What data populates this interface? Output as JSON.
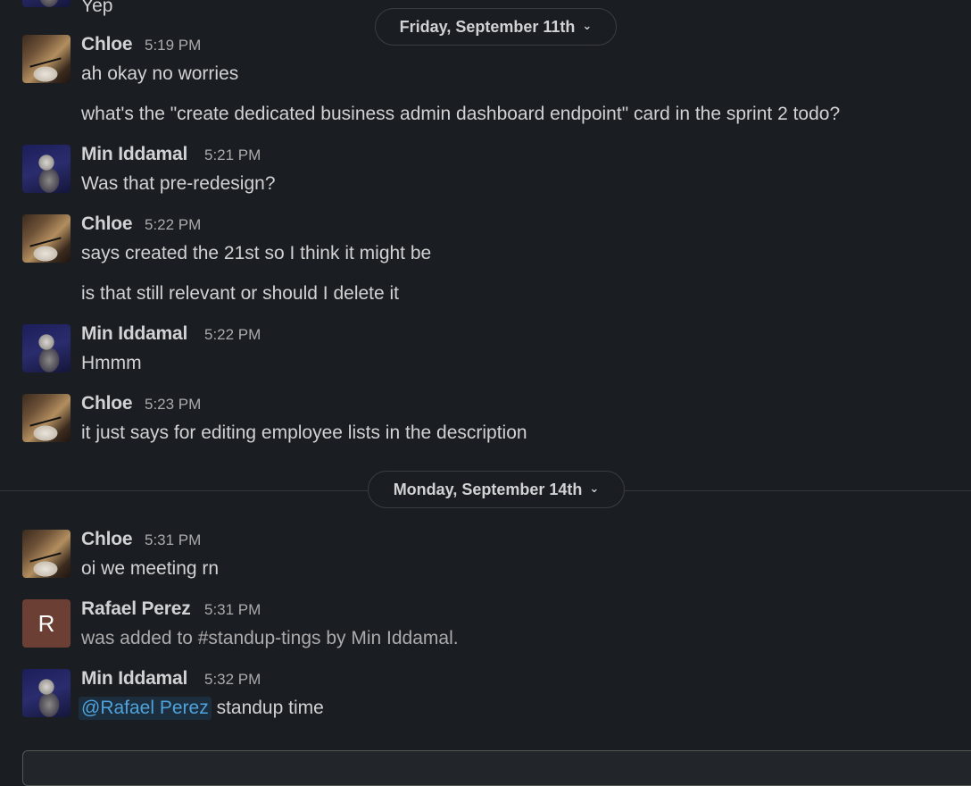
{
  "top_partial": {
    "text": "Yep"
  },
  "dividers": [
    {
      "label": "Friday, September 11th",
      "icon": "chevron-down-icon"
    },
    {
      "label": "Monday, September 14th",
      "icon": "chevron-down-icon"
    }
  ],
  "messages": [
    {
      "name": "Chloe",
      "time": "5:19 PM",
      "lines": [
        "ah okay no worries",
        "what's the \"create dedicated business admin dashboard endpoint\" card in the sprint 2 todo?"
      ]
    },
    {
      "name": "Min Iddamal",
      "time": "5:21 PM",
      "lines": [
        "Was that pre-redesign?"
      ]
    },
    {
      "name": "Chloe",
      "time": "5:22 PM",
      "lines": [
        "says created the 21st so I think it might be",
        "is that still relevant or should I delete it"
      ]
    },
    {
      "name": "Min Iddamal",
      "time": "5:22 PM",
      "lines": [
        "Hmmm"
      ]
    },
    {
      "name": "Chloe",
      "time": "5:23 PM",
      "lines": [
        "it just says for editing employee lists in the description"
      ]
    },
    {
      "name": "Chloe",
      "time": "5:31 PM",
      "lines": [
        "oi we meeting rn"
      ]
    },
    {
      "name": "Rafael Perez",
      "time": "5:31 PM",
      "avatar_letter": "R",
      "lines": [
        "was added to #standup-tings by Min Iddamal."
      ]
    },
    {
      "name": "Min Iddamal",
      "time": "5:32 PM",
      "mention": "@Rafael Perez",
      "lines": [
        "standup time"
      ]
    }
  ],
  "colors": {
    "background": "#1a1d21",
    "text": "#d1d2d3",
    "muted": "#ababad",
    "mention": "#4fa3dc",
    "mention_bg": "#1c2d3d"
  }
}
